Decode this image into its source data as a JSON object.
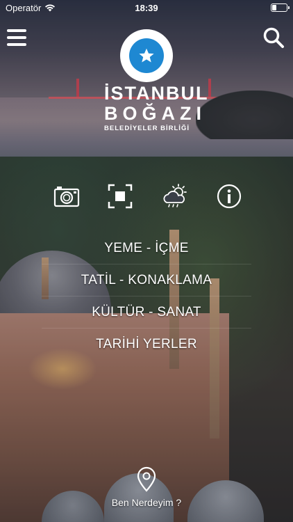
{
  "status_bar": {
    "carrier": "Operatör",
    "time": "18:39"
  },
  "logo": {
    "line1": "İSTANBUL",
    "line2": "BOĞAZI",
    "line3": "BELEDİYELER BİRLİĞİ",
    "star_color": "#1e88d2"
  },
  "icons": {
    "menu": "hamburger-menu-icon",
    "search": "search-icon",
    "camera": "camera-icon",
    "focus": "focus-frame-icon",
    "weather": "weather-cloud-sun-icon",
    "info": "info-icon",
    "location": "location-pin-icon"
  },
  "menu_items": [
    {
      "label": "YEME - İÇME"
    },
    {
      "label": "TATİL - KONAKLAMA"
    },
    {
      "label": "KÜLTÜR - SANAT"
    },
    {
      "label": "TARİHİ YERLER"
    }
  ],
  "location": {
    "label": "Ben Nerdeyim ?"
  }
}
